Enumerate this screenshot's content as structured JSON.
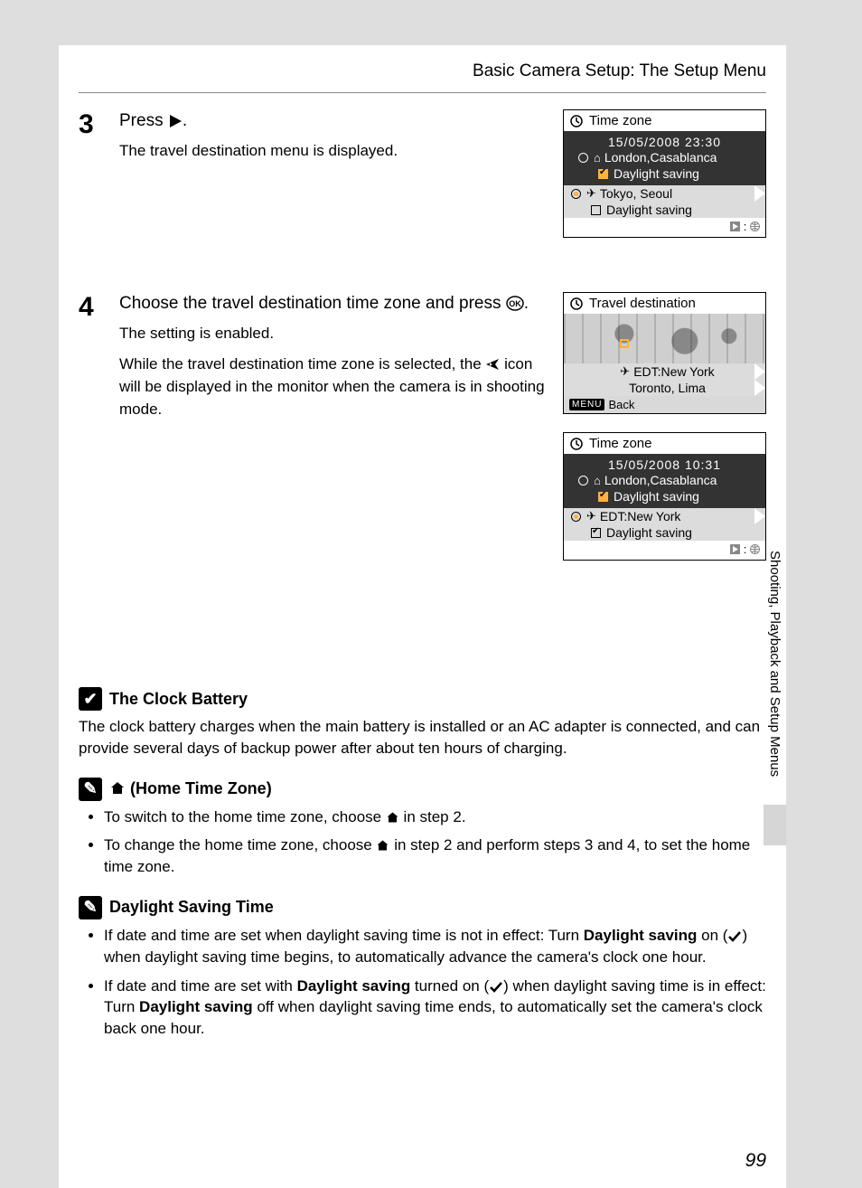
{
  "header": "Basic Camera Setup: The Setup Menu",
  "sideTab": "Shooting, Playback and Setup Menus",
  "pageNumber": "99",
  "step3": {
    "num": "3",
    "titlePrefix": "Press ",
    "titleSuffix": ".",
    "body": "The travel destination menu is displayed."
  },
  "step4": {
    "num": "4",
    "titlePrefix": "Choose the travel destination time zone and press ",
    "titleSuffix": ".",
    "body1": "The setting is enabled.",
    "body2a": "While the travel destination time zone is selected, the ",
    "body2b": " icon will be displayed in the monitor when the camera is in shooting mode."
  },
  "lcd1": {
    "title": "Time zone",
    "datetime": "15/05/2008   23:30",
    "home": "London,Casablanca",
    "homeDst": "Daylight saving",
    "dest": "Tokyo, Seoul",
    "destDst": "Daylight saving"
  },
  "lcd2": {
    "title": "Travel destination",
    "line1": "EDT:New York",
    "line2": "Toronto, Lima",
    "back": "Back",
    "menu": "MENU"
  },
  "lcd3": {
    "title": "Time zone",
    "datetime": "15/05/2008   10:31",
    "home": "London,Casablanca",
    "homeDst": "Daylight saving",
    "dest": "EDT:New York",
    "destDst": "Daylight saving"
  },
  "noteClock": {
    "title": "The Clock Battery",
    "body": "The clock battery charges when the main battery is installed or an AC adapter is connected, and can provide several days of backup power after about ten hours of charging."
  },
  "noteHome": {
    "title": " (Home Time Zone)",
    "li1a": "To switch to the home time zone, choose ",
    "li1b": " in step 2.",
    "li2a": "To change the home time zone, choose ",
    "li2b": " in step 2 and perform steps 3 and 4, to set the home time zone."
  },
  "noteDst": {
    "title": "Daylight Saving Time",
    "li1a": "If date and time are set when daylight saving time is not in effect: Turn ",
    "li1bold": "Daylight saving",
    "li1b": " on (",
    "li1c": ") when daylight saving time begins, to automatically advance the camera's clock one hour.",
    "li2a": "If date and time are set with ",
    "li2bold": "Daylight saving",
    "li2b": " turned on (",
    "li2c": ") when daylight saving time is in effect: Turn ",
    "li2bold2": "Daylight saving",
    "li2d": " off when daylight saving time ends, to automatically set the camera's clock back one hour."
  }
}
